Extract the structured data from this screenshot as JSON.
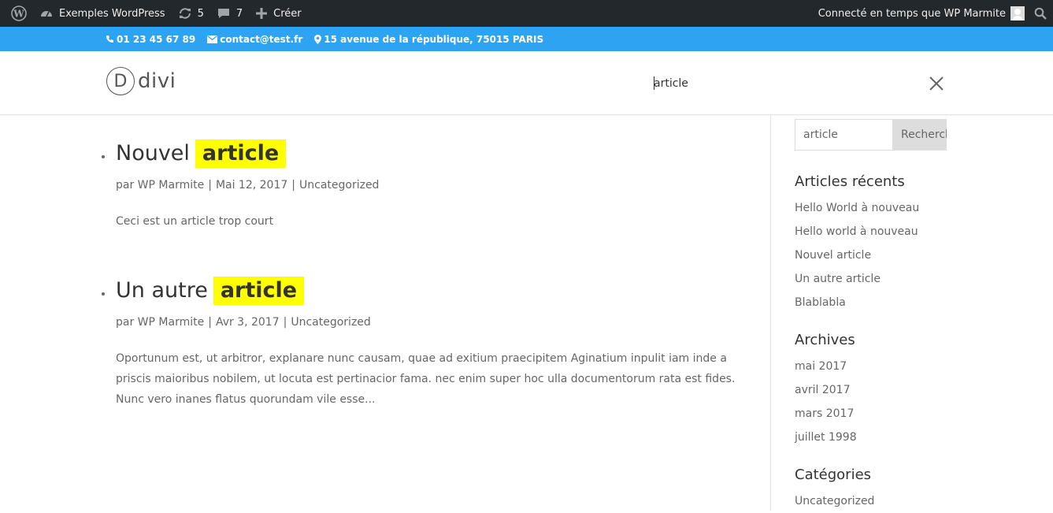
{
  "adminbar": {
    "site_name": "Exemples WordPress",
    "updates_count": "5",
    "comments_count": "7",
    "new_label": "Créer",
    "account_label": "Connecté en temps que WP Marmite"
  },
  "topbar": {
    "phone": "01 23 45 67 89",
    "email": "contact@test.fr",
    "address": "15 avenue de la république, 75015 PARIS"
  },
  "header": {
    "logo_letter": "D",
    "logo_text": "divi",
    "search_value": "article"
  },
  "posts": [
    {
      "title_prefix": "Nouvel",
      "title_highlight": "article",
      "author": "par WP Marmite",
      "date": "Mai 12, 2017",
      "category": "Uncategorized",
      "excerpt": "Ceci est un article trop court"
    },
    {
      "title_prefix": "Un autre",
      "title_highlight": "article",
      "author": "par WP Marmite",
      "date": "Avr 3, 2017",
      "category": "Uncategorized",
      "excerpt": "Oportunum est, ut arbitror, explanare nunc causam, quae ad exitium praecipitem Aginatium inpulit iam inde a priscis maioribus nobilem, ut locuta est pertinacior fama. nec enim super hoc ulla documentorum rata est fides. Nunc vero inanes flatus quorundam vile esse..."
    }
  ],
  "sidebar": {
    "search_value": "article",
    "search_button": "Rechercher",
    "recent": {
      "title": "Articles récents",
      "items": [
        "Hello World à nouveau",
        "Hello world à nouveau",
        "Nouvel article",
        "Un autre article",
        "Blablabla"
      ]
    },
    "archives": {
      "title": "Archives",
      "items": [
        "mai 2017",
        "avril 2017",
        "mars 2017",
        "juillet 1998"
      ]
    },
    "categories": {
      "title": "Catégories",
      "items": [
        "Uncategorized"
      ]
    }
  },
  "colors": {
    "adminbar_bg": "#23282d",
    "topbar_bg": "#2ea3f2",
    "highlight": "#ffff00"
  }
}
